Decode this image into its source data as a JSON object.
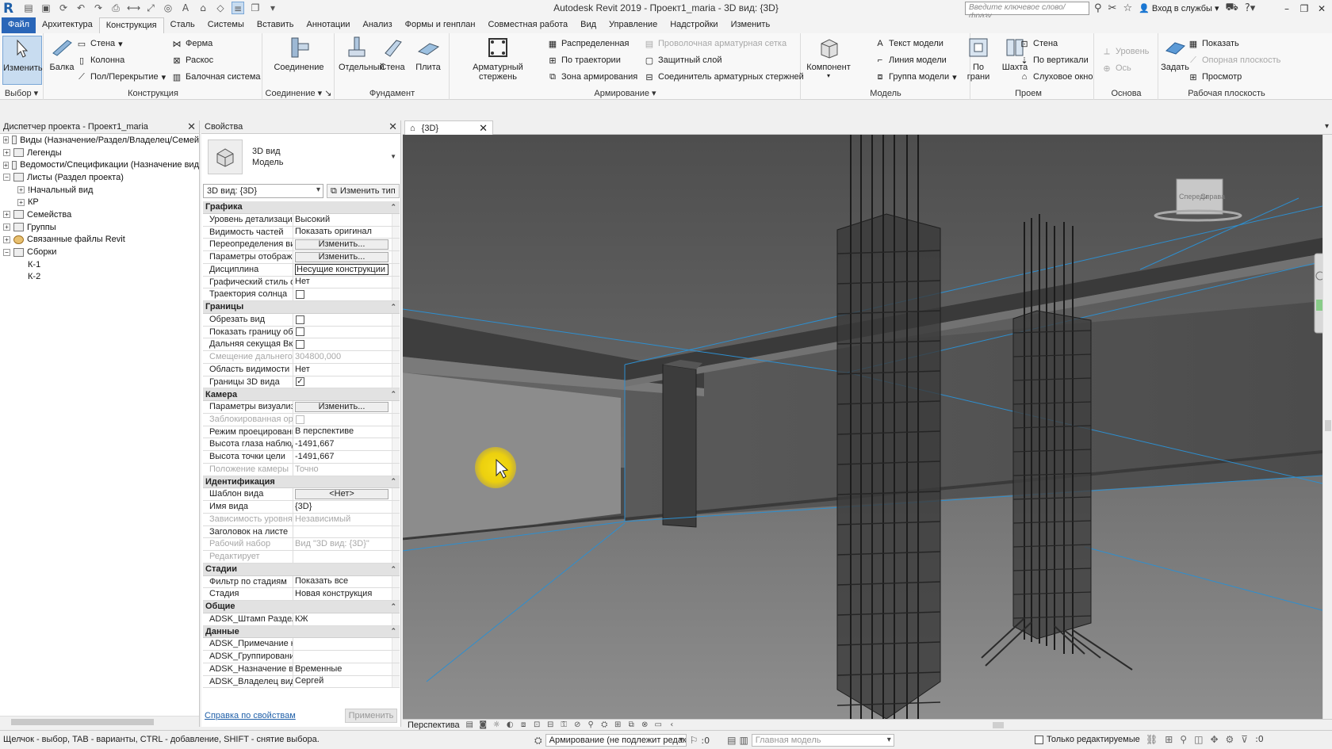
{
  "title_bar": {
    "title": "Autodesk Revit 2019 - Проект1_maria - 3D вид: {3D}",
    "search_placeholder": "Введите ключевое слово/фразу",
    "login_label": "Вход в службы"
  },
  "ribbon_tabs": [
    "Файл",
    "Архитектура",
    "Конструкция",
    "Сталь",
    "Системы",
    "Вставить",
    "Аннотации",
    "Анализ",
    "Формы и генплан",
    "Совместная работа",
    "Вид",
    "Управление",
    "Надстройки",
    "Изменить"
  ],
  "active_tab": "Конструкция",
  "ribbon": {
    "select": {
      "modify": "Изменить",
      "label": "Выбор"
    },
    "structure": {
      "beam": "Балка",
      "wall": "Стена",
      "column": "Колонна",
      "floor": "Пол/Перекрытие",
      "truss": "Ферма",
      "brace": "Раскос",
      "beam_system": "Балочная система",
      "label": "Конструкция"
    },
    "connection": {
      "connection": "Соединение",
      "label": "Соединение"
    },
    "foundation": {
      "isolated": "Отдельный",
      "wall": "Стена",
      "slab": "Плита",
      "label": "Фундамент"
    },
    "reinforcement": {
      "rebar": "Арматурный стержень",
      "area": "Распределенная",
      "path": "По траектории",
      "fabric_area": "Зона армирования",
      "fabric_sheet": "Проволочная арматурная сетка",
      "cover": "Защитный слой",
      "coupler": "Соединитель арматурных стержней",
      "label": "Армирование"
    },
    "model": {
      "component": "Компонент",
      "model_text": "Текст модели",
      "model_line": "Линия модели",
      "model_group": "Группа модели",
      "label": "Модель"
    },
    "opening": {
      "by_face": "По грани",
      "shaft": "Шахта",
      "wall": "Стена",
      "vertical": "По вертикали",
      "dormer": "Слуховое окно",
      "label": "Проем"
    },
    "datum": {
      "level": "Уровень",
      "grid": "Ось",
      "label": "Основа"
    },
    "work_plane": {
      "set": "Задать",
      "show": "Показать",
      "ref_plane": "Опорная плоскость",
      "viewer": "Просмотр",
      "label": "Рабочая плоскость"
    }
  },
  "project_browser": {
    "title": "Диспетчер проекта - Проект1_maria",
    "items": [
      {
        "label": "Виды (Назначение/Раздел/Владелец/Семей",
        "depth": 0,
        "expander": "+",
        "icon": "views"
      },
      {
        "label": "Легенды",
        "depth": 0,
        "expander": "+",
        "icon": "legend"
      },
      {
        "label": "Ведомости/Спецификации (Назначение вид",
        "depth": 0,
        "expander": "+",
        "icon": "schedule"
      },
      {
        "label": "Листы (Раздел проекта)",
        "depth": 0,
        "expander": "−",
        "icon": "sheets"
      },
      {
        "label": "!Начальный вид",
        "depth": 1,
        "expander": "+",
        "icon": ""
      },
      {
        "label": "КР",
        "depth": 1,
        "expander": "+",
        "icon": ""
      },
      {
        "label": "Семейства",
        "depth": 0,
        "expander": "+",
        "icon": "families"
      },
      {
        "label": "Группы",
        "depth": 0,
        "expander": "+",
        "icon": "groups"
      },
      {
        "label": "Связанные файлы Revit",
        "depth": 0,
        "expander": "+",
        "icon": "links"
      },
      {
        "label": "Сборки",
        "depth": 0,
        "expander": "−",
        "icon": "assemblies"
      },
      {
        "label": "К-1",
        "depth": 1,
        "expander": "",
        "icon": ""
      },
      {
        "label": "К-2",
        "depth": 1,
        "expander": "",
        "icon": ""
      }
    ]
  },
  "properties": {
    "title": "Свойства",
    "type_name_1": "3D вид",
    "type_name_2": "Модель",
    "type_selector": "3D вид: {3D}",
    "edit_type": "Изменить тип",
    "sections": [
      {
        "name": "Графика",
        "rows": [
          {
            "label": "Уровень детализации",
            "value": "Высокий"
          },
          {
            "label": "Видимость частей",
            "value": "Показать оригинал"
          },
          {
            "label": "Переопределения ви...",
            "value": "Изменить...",
            "kind": "button"
          },
          {
            "label": "Параметры отображ...",
            "value": "Изменить...",
            "kind": "button"
          },
          {
            "label": "Дисциплина",
            "value": "Несущие конструкции",
            "kind": "edit"
          },
          {
            "label": "Графический стиль о...",
            "value": "Нет"
          },
          {
            "label": "Траектория солнца",
            "value": "",
            "kind": "checkbox",
            "checked": false
          }
        ]
      },
      {
        "name": "Границы",
        "rows": [
          {
            "label": "Обрезать вид",
            "value": "",
            "kind": "checkbox",
            "checked": false
          },
          {
            "label": "Показать границу об...",
            "value": "",
            "kind": "checkbox",
            "checked": false
          },
          {
            "label": "Дальняя секущая Вкл",
            "value": "",
            "kind": "checkbox",
            "checked": false
          },
          {
            "label": "Смещение дальнего ...",
            "value": "304800,000",
            "dim": true
          },
          {
            "label": "Область видимости",
            "value": "Нет"
          },
          {
            "label": "Границы 3D вида",
            "value": "",
            "kind": "checkbox",
            "checked": true
          }
        ]
      },
      {
        "name": "Камера",
        "rows": [
          {
            "label": "Параметры визуализ...",
            "value": "Изменить...",
            "kind": "button"
          },
          {
            "label": "Заблокированная ор...",
            "value": "",
            "kind": "checkbox",
            "checked": false,
            "dim": true
          },
          {
            "label": "Режим проецирования",
            "value": "В перспективе"
          },
          {
            "label": "Высота глаза наблюд...",
            "value": "-1491,667"
          },
          {
            "label": "Высота точки цели",
            "value": "-1491,667"
          },
          {
            "label": "Положение камеры",
            "value": "Точно",
            "dim": true
          }
        ]
      },
      {
        "name": "Идентификация",
        "rows": [
          {
            "label": "Шаблон вида",
            "value": "<Нет>",
            "kind": "button"
          },
          {
            "label": "Имя вида",
            "value": "{3D}"
          },
          {
            "label": "Зависимость уровня",
            "value": "Независимый",
            "dim": true
          },
          {
            "label": "Заголовок на листе",
            "value": ""
          },
          {
            "label": "Рабочий набор",
            "value": "Вид \"3D вид: {3D}\"",
            "dim": true
          },
          {
            "label": "Редактирует",
            "value": "",
            "dim": true
          }
        ]
      },
      {
        "name": "Стадии",
        "rows": [
          {
            "label": "Фильтр по стадиям",
            "value": "Показать все"
          },
          {
            "label": "Стадия",
            "value": "Новая конструкция"
          }
        ]
      },
      {
        "name": "Общие",
        "rows": [
          {
            "label": "ADSK_Штамп Раздел ...",
            "value": "КЖ"
          }
        ]
      },
      {
        "name": "Данные",
        "rows": [
          {
            "label": "ADSK_Примечание к ...",
            "value": ""
          },
          {
            "label": "ADSK_Группирование",
            "value": ""
          },
          {
            "label": "ADSK_Назначение вида",
            "value": "Временные"
          },
          {
            "label": "ADSK_Владелец вида",
            "value": "Сергей"
          }
        ]
      }
    ],
    "help_link": "Справка по свойствам",
    "apply": "Применить"
  },
  "view": {
    "tab_label": "{3D}",
    "viewcube_labels": [
      "Спереди",
      "Справа"
    ]
  },
  "view_control": {
    "projection": "Перспектива"
  },
  "status_bar": {
    "hint": "Щелчок - выбор, TAB - варианты, CTRL - добавление, SHIFT - снятие выбора.",
    "workset": "Армирование (не подлежит редак",
    "count": ":0",
    "design_option": "Главная модель",
    "editable_only": "Только редактируемые",
    "filter_count": ":0"
  },
  "colors": {
    "file_tab": "#2a66b8",
    "accent": "#1f5fa8",
    "cursor_highlight": "#f0d20a",
    "section_box": "#2d8fd0"
  }
}
